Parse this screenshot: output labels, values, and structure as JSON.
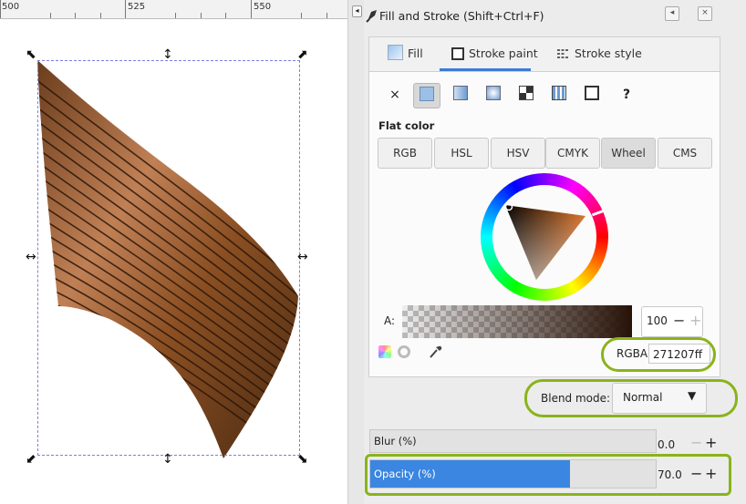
{
  "ruler": {
    "ticks": [
      "500",
      "525",
      "550"
    ]
  },
  "dialog": {
    "title": "Fill and Stroke (Shift+Ctrl+F)",
    "tabs": [
      {
        "label": "Fill"
      },
      {
        "label": "Stroke paint"
      },
      {
        "label": "Stroke style"
      }
    ],
    "active_tab": "Stroke paint",
    "paint_types": [
      "no-paint",
      "flat-color",
      "linear-gradient",
      "radial-gradient",
      "pattern",
      "swatch",
      "unset"
    ],
    "paint_none_glyph": "×",
    "paint_unset_glyph": "?",
    "flat_color_label": "Flat color",
    "color_modes": [
      "RGB",
      "HSL",
      "HSV",
      "CMYK",
      "Wheel",
      "CMS"
    ],
    "active_mode": "Wheel",
    "alpha": {
      "label": "A:",
      "value": "100"
    },
    "rgba": {
      "label": "RGBA:",
      "value": "271207ff"
    },
    "blend": {
      "label": "Blend mode:",
      "value": "Normal"
    },
    "blur": {
      "label": "Blur (%)",
      "value": "0.0",
      "fraction": 0.0
    },
    "opacity": {
      "label": "Opacity (%)",
      "value": "70.0",
      "fraction": 0.7
    },
    "spin_minus": "−",
    "spin_plus": "+"
  },
  "colors": {
    "accent": "#3a7bd5",
    "highlight": "#8ab31c",
    "current_color": "#271207"
  }
}
